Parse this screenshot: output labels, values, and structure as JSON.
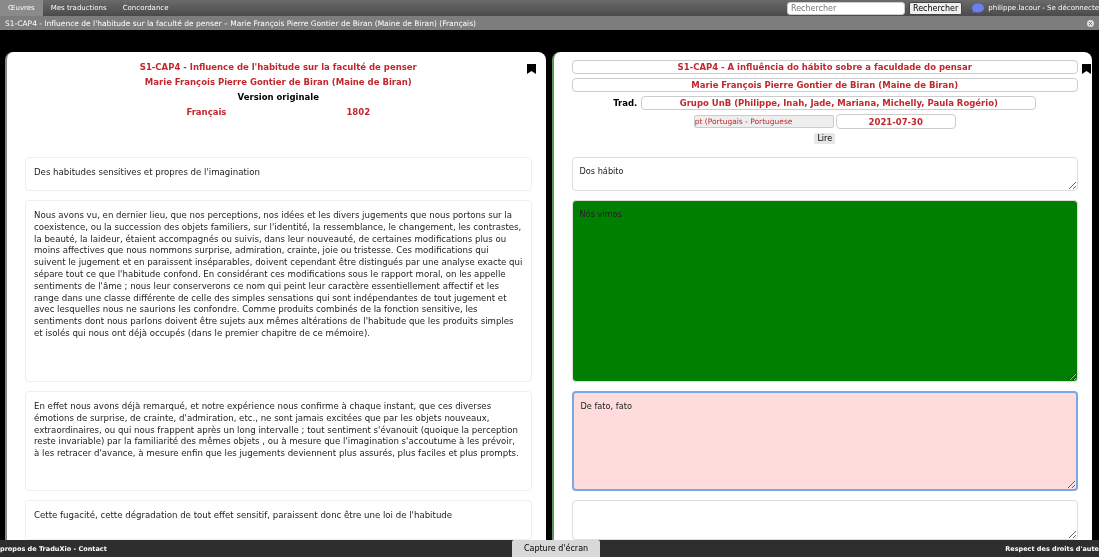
{
  "menu": {
    "tabs": [
      {
        "label": "Œuvres",
        "selected": true
      },
      {
        "label": "Mes traductions",
        "selected": false
      },
      {
        "label": "Concordance",
        "selected": false
      }
    ],
    "search": {
      "placeholder": "Rechercher",
      "button": "Rechercher"
    },
    "user": "philippe.lacour - Se déconnecte"
  },
  "breadcrumb": "S1-CAP4 - Influence de l'habitude sur la faculté de penser – Marie François Pierre Gontier de Biran (Maine de Biran) (Français)",
  "original": {
    "title": "S1-CAP4 - Influence de l'habitude sur la faculté de penser",
    "author": "Marie François Pierre Gontier de Biran (Maine de Biran)",
    "version_label": "Version originale",
    "language": "Français",
    "date": "1802"
  },
  "translation": {
    "title": "S1-CAP4 - A influência do hábito sobre a faculdade do pensar",
    "author": "Marie François Pierre Gontier de Biran (Maine de Biran)",
    "translator_label": "Trad.",
    "translator": "Grupo UnB (Philippe, Inah, Jade, Mariana, Michelly, Paula Rogério)",
    "language": "pt (Portugais - Portuguese",
    "date": "2021-07-30",
    "read_button": "Lire"
  },
  "segments": [
    {
      "original": "Des habitudes sensitives et propres de l'imagination",
      "translation": "Dos hábito",
      "color": "#ffffff",
      "focused": false
    },
    {
      "original": "Nous avons vu, en dernier lieu, que nos perceptions, nos idées et les divers jugements que nous portons sur la coexistence, ou la succession des objets familiers, sur l'identité, la ressemblance, le changement, les contrastes, la beauté, la laideur, étaient accompagnés ou suivis, dans leur nouveauté, de certaines modifications plus ou moins affectives que nous nommons surprise, admiration, crainte, joie ou tristesse. Ces modifications qui suivent le jugement et en paraissent inséparables, doivent cependant être distingués par une analyse exacte qui sépare tout ce que l'habitude confond. En considérant ces modifications sous le rapport moral, on les appelle sentiments de l'âme   ; nous leur conserverons ce nom qui peint leur caractère essentiellement affectif et les range dans une classe différente de celle des simples sensations qui sont indépendantes de tout jugement et avec lesquelles nous ne saurions les confondre. Comme produits combinés de la fonction sensitive, les sentiments dont nous parlons doivent être sujets aux mêmes altérations de l'habitude que les produits simples et isolés qui nous ont déjà occupés (dans le premier chapitre de ce mémoire).",
      "translation": "Nós vimos",
      "color": "#008000",
      "focused": false
    },
    {
      "original": "En effet nous avons déjà remarqué, et notre expérience nous confirme à chaque instant, que ces diverses émotions de surprise, de crainte, d'admiration, etc., ne sont jamais excitées que par les objets nouveaux, extraordinaires, ou qui nous frappent après un long intervalle ; tout sentiment s'évanouit (quoique la perception reste invariable) par la familiarité des mêmes objets  , ou à mesure que l'imagination s'accoutume à les prévoir, à les retracer d'avance, à mesure enfin que les jugements deviennent plus assurés, plus faciles et plus prompts.",
      "translation": "De fato, fato",
      "color": "#fddcdb",
      "focused": true
    },
    {
      "original": "Cette fugacité, cette dégradation de tout effet sensitif, paraissent donc être une loi de l'habitude",
      "color": "#ffffff",
      "focused": false
    }
  ],
  "footer": {
    "about": "propos de TraduXio - Contact",
    "screenshot_button": "Capture d'écran",
    "rights": "Respect des droits d'aute"
  }
}
